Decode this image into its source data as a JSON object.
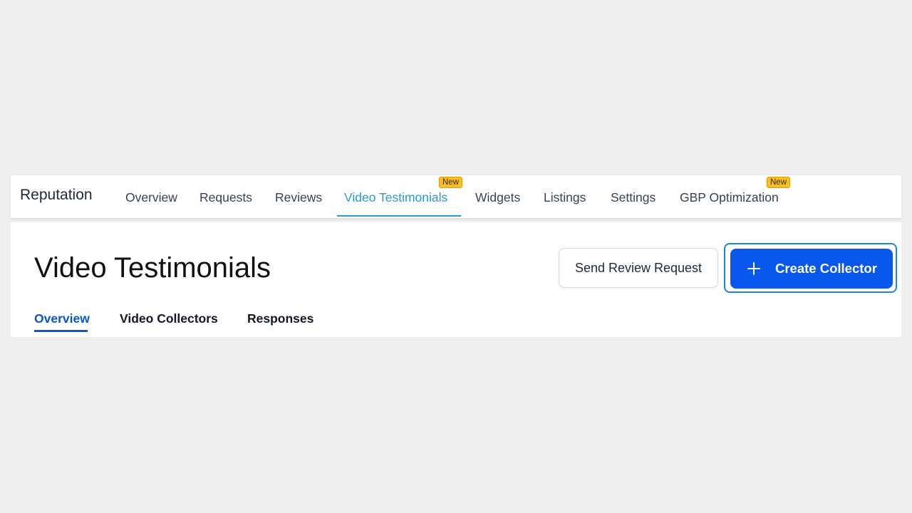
{
  "topnav": {
    "app_title": "Reputation",
    "items": [
      {
        "label": "Overview",
        "active": false
      },
      {
        "label": "Requests",
        "active": false
      },
      {
        "label": "Reviews",
        "active": false
      },
      {
        "label": "Video Testimonials",
        "active": true,
        "badge": "New"
      },
      {
        "label": "Widgets",
        "active": false
      },
      {
        "label": "Listings",
        "active": false
      },
      {
        "label": "Settings",
        "active": false
      },
      {
        "label": "GBP Optimization",
        "active": false,
        "badge": "New"
      }
    ]
  },
  "header": {
    "title": "Video Testimonials",
    "send_review_label": "Send Review Request",
    "create_collector_label": "Create Collector",
    "create_collector_icon": "plus-icon"
  },
  "subtabs": [
    {
      "label": "Overview",
      "active": true
    },
    {
      "label": "Video Collectors",
      "active": false
    },
    {
      "label": "Responses",
      "active": false
    }
  ],
  "colors": {
    "background": "#efefef",
    "nav_active": "#2a9ad3",
    "primary": "#0a57ee",
    "primary_focus_ring": "#1a87d4",
    "badge": "#fbbf24",
    "subtab_active": "#0a57c8"
  }
}
